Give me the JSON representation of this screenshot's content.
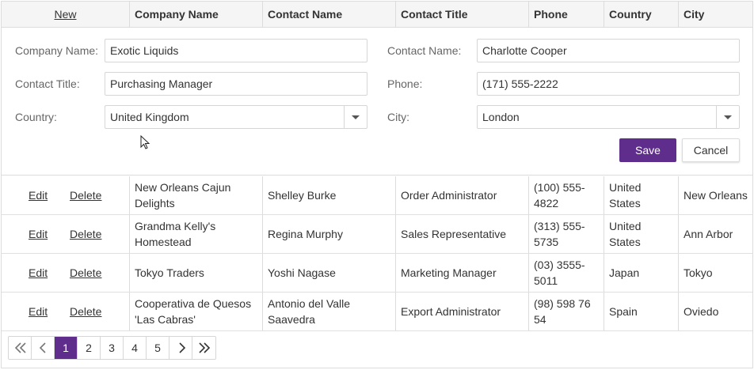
{
  "header": {
    "new_label": "New",
    "columns": [
      "Company Name",
      "Contact Name",
      "Contact Title",
      "Phone",
      "Country",
      "City"
    ]
  },
  "edit_form": {
    "company_name": {
      "label": "Company Name:",
      "value": "Exotic Liquids"
    },
    "contact_name": {
      "label": "Contact Name:",
      "value": "Charlotte Cooper"
    },
    "contact_title": {
      "label": "Contact Title:",
      "value": "Purchasing Manager"
    },
    "phone": {
      "label": "Phone:",
      "value": "(171) 555-2222"
    },
    "country": {
      "label": "Country:",
      "value": "United Kingdom"
    },
    "city": {
      "label": "City:",
      "value": "London"
    },
    "save_label": "Save",
    "cancel_label": "Cancel"
  },
  "actions": {
    "edit": "Edit",
    "delete": "Delete"
  },
  "rows": [
    {
      "company": "New Orleans Cajun Delights",
      "contact": "Shelley Burke",
      "title": "Order Administrator",
      "phone": "(100) 555-4822",
      "country": "United States",
      "city": "New Orleans"
    },
    {
      "company": "Grandma Kelly's Homestead",
      "contact": "Regina Murphy",
      "title": "Sales Representative",
      "phone": "(313) 555-5735",
      "country": "United States",
      "city": "Ann Arbor"
    },
    {
      "company": "Tokyo Traders",
      "contact": "Yoshi Nagase",
      "title": "Marketing Manager",
      "phone": "(03) 3555-5011",
      "country": "Japan",
      "city": "Tokyo"
    },
    {
      "company": "Cooperativa de Quesos 'Las Cabras'",
      "contact": "Antonio del Valle Saavedra",
      "title": "Export Administrator",
      "phone": "(98) 598 76 54",
      "country": "Spain",
      "city": "Oviedo"
    }
  ],
  "pager": {
    "pages": [
      "1",
      "2",
      "3",
      "4",
      "5"
    ],
    "current_page": 1,
    "first_icon": "double-chevron-left-icon",
    "prev_icon": "chevron-left-icon",
    "next_icon": "chevron-right-icon",
    "last_icon": "double-chevron-right-icon"
  },
  "colors": {
    "accent": "#5f2d8c",
    "header_bg": "#f5f5f5",
    "border": "#dcdcdc"
  }
}
